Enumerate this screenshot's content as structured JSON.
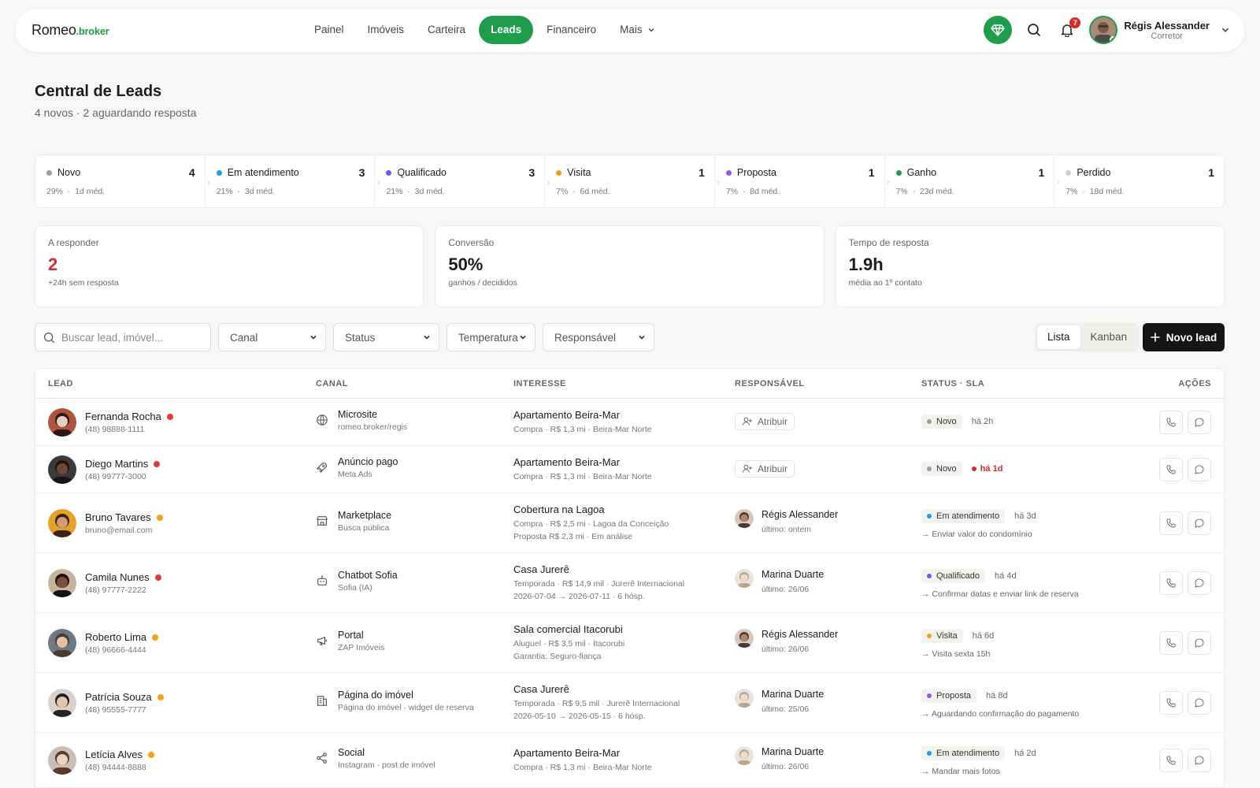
{
  "brand": {
    "name": "Romeo",
    "suffix": ".broker"
  },
  "nav": {
    "items": [
      {
        "label": "Painel"
      },
      {
        "label": "Imóveis"
      },
      {
        "label": "Carteira"
      },
      {
        "label": "Leads"
      },
      {
        "label": "Financeiro"
      },
      {
        "label": "Mais"
      }
    ],
    "active": "Leads",
    "notifications": "7",
    "user": {
      "name": "Régis Alessander",
      "role": "Corretor"
    }
  },
  "page": {
    "title": "Central de Leads",
    "subtitle": "4 novos · 2 aguardando resposta"
  },
  "pipeline": [
    {
      "name": "Novo",
      "count": "4",
      "pct": "29%",
      "avg": "1d méd.",
      "color": "#9e9e9e"
    },
    {
      "name": "Em atendimento",
      "count": "3",
      "pct": "21%",
      "avg": "3d méd.",
      "color": "#1aa3e0"
    },
    {
      "name": "Qualificado",
      "count": "3",
      "pct": "21%",
      "avg": "3d méd.",
      "color": "#6b5ce7"
    },
    {
      "name": "Visita",
      "count": "1",
      "pct": "7%",
      "avg": "6d méd.",
      "color": "#f29d1d"
    },
    {
      "name": "Proposta",
      "count": "1",
      "pct": "7%",
      "avg": "8d méd.",
      "color": "#8d5ce7"
    },
    {
      "name": "Ganho",
      "count": "1",
      "pct": "7%",
      "avg": "23d méd.",
      "color": "#1f9d4c"
    },
    {
      "name": "Perdido",
      "count": "1",
      "pct": "7%",
      "avg": "18d méd.",
      "color": "#cfcfcf"
    }
  ],
  "kpis": [
    {
      "label": "A responder",
      "value": "2",
      "sub": "+24h sem resposta",
      "color": "#d62b2b"
    },
    {
      "label": "Conversão",
      "value": "50%",
      "sub": "ganhos / decididos",
      "color": "#1c1c1c"
    },
    {
      "label": "Tempo de resposta",
      "value": "1.9h",
      "sub": "média ao 1º contato",
      "color": "#1c1c1c"
    }
  ],
  "filters": {
    "search_placeholder": "Buscar lead, imóvel...",
    "selects": [
      "Canal",
      "Status",
      "Temperatura",
      "Responsável"
    ],
    "views": [
      "Lista",
      "Kanban"
    ],
    "active_view": "Lista",
    "new_label": "Novo lead"
  },
  "table": {
    "headers": [
      "LEAD",
      "CANAL",
      "INTERESSE",
      "RESPONSÁVEL",
      "STATUS · SLA",
      "AÇÕES"
    ],
    "rows": [
      {
        "name": "Fernanda Rocha",
        "temp": "#e03a3a",
        "contact": "(48) 98888-1111",
        "channel_icon": "globe-icon",
        "channel": "Microsite",
        "channel_sub": "romeo.broker/regis",
        "interest": "Apartamento Beira-Mar",
        "interest_sub": [
          "Compra · R$ 1,3 mi · Beira-Mar Norte"
        ],
        "assignee": null,
        "assign_label": "Atribuir",
        "status": "Novo",
        "status_color": "#9e9e9e",
        "ago": "há 2h",
        "late": false,
        "next": ""
      },
      {
        "name": "Diego Martins",
        "temp": "#e03a3a",
        "contact": "(48) 99777-3000",
        "channel_icon": "rocket-icon",
        "channel": "Anúncio pago",
        "channel_sub": "Meta Ads",
        "interest": "Apartamento Beira-Mar",
        "interest_sub": [
          "Compra · R$ 1,3 mi · Beira-Mar Norte"
        ],
        "assignee": null,
        "assign_label": "Atribuir",
        "status": "Novo",
        "status_color": "#9e9e9e",
        "ago": "há 1d",
        "late": true,
        "next": ""
      },
      {
        "name": "Bruno Tavares",
        "temp": "#f2a31d",
        "contact": "bruno@email.com",
        "channel_icon": "store-icon",
        "channel": "Marketplace",
        "channel_sub": "Busca pública",
        "interest": "Cobertura na Lagoa",
        "interest_sub": [
          "Compra · R$ 2,5 mi · Lagoa da Conceição",
          "Proposta R$ 2,3 mi · Em análise"
        ],
        "assignee": "Régis Alessander",
        "assignee_sub": "último: ontem",
        "status": "Em atendimento",
        "status_color": "#1aa3e0",
        "ago": "há 3d",
        "late": false,
        "next": "→ Enviar valor do condomínio"
      },
      {
        "name": "Camila Nunes",
        "temp": "#e03a3a",
        "contact": "(48) 97777-2222",
        "channel_icon": "bot-icon",
        "channel": "Chatbot Sofia",
        "channel_sub": "Sofia (IA)",
        "interest": "Casa Jurerê",
        "interest_sub": [
          "Temporada · R$ 14,9 mil · Jurerê Internacional",
          "2026-07-04 → 2026-07-11 · 6 hósp."
        ],
        "assignee": "Marina Duarte",
        "assignee_sub": "último: 26/06",
        "status": "Qualificado",
        "status_color": "#6b5ce7",
        "ago": "há 4d",
        "late": false,
        "next": "→ Confirmar datas e enviar link de reserva"
      },
      {
        "name": "Roberto Lima",
        "temp": "#f2a31d",
        "contact": "(48) 96666-4444",
        "channel_icon": "megaphone-icon",
        "channel": "Portal",
        "channel_sub": "ZAP Imóveis",
        "interest": "Sala comercial Itacorubi",
        "interest_sub": [
          "Aluguel · R$ 3,5 mil · Itacorubi",
          "Garantia: Seguro-fiança"
        ],
        "assignee": "Régis Alessander",
        "assignee_sub": "último: 26/06",
        "status": "Visita",
        "status_color": "#f29d1d",
        "ago": "há 6d",
        "late": false,
        "next": "→ Visita sexta 15h"
      },
      {
        "name": "Patrícia Souza",
        "temp": "#f2a31d",
        "contact": "(48) 95555-7777",
        "channel_icon": "building-icon",
        "channel": "Página do imóvel",
        "channel_sub": "Página do imóvel · widget de reserva",
        "interest": "Casa Jurerê",
        "interest_sub": [
          "Temporada · R$ 9,5 mil · Jurerê Internacional",
          "2026-05-10 → 2026-05-15 · 6 hósp."
        ],
        "assignee": "Marina Duarte",
        "assignee_sub": "último: 25/06",
        "status": "Proposta",
        "status_color": "#8d5ce7",
        "ago": "há 8d",
        "late": false,
        "next": "→ Aguardando confirmação do pagamento"
      },
      {
        "name": "Letícia Alves",
        "temp": "#f2a31d",
        "contact": "(48) 94444-8888",
        "channel_icon": "share-icon",
        "channel": "Social",
        "channel_sub": "Instagram · post de imóvel",
        "interest": "Apartamento Beira-Mar",
        "interest_sub": [
          "Compra · R$ 1,3 mi · Beira-Mar Norte"
        ],
        "assignee": "Marina Duarte",
        "assignee_sub": "último: 26/06",
        "status": "Em atendimento",
        "status_color": "#1aa3e0",
        "ago": "há 2d",
        "late": false,
        "next": "→ Mandar mais fotos"
      }
    ]
  }
}
